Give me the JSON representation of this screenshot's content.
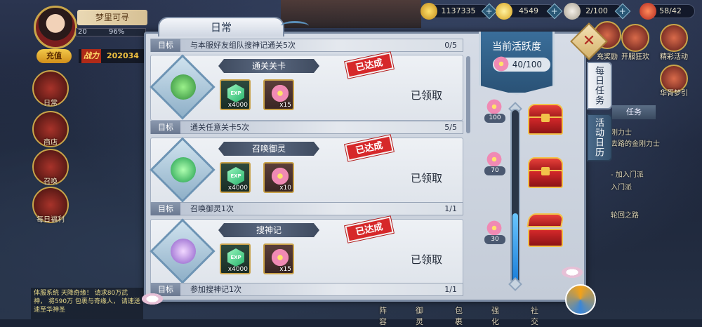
{
  "resources": {
    "gold": "1137335",
    "ingot": "4549",
    "stamina": "2/100",
    "energy": "58/42"
  },
  "player": {
    "name": "梦里可寻",
    "level": "20",
    "exp_percent": "96%",
    "recharge_label": "充值",
    "power_label": "战力",
    "power_value": "202034"
  },
  "left_nav": [
    {
      "label": "日常",
      "icon": "daily-icon"
    },
    {
      "label": "商店",
      "icon": "shop-icon"
    },
    {
      "label": "召唤",
      "icon": "summon-icon"
    },
    {
      "label": "每日福利",
      "icon": "daily-welfare-icon"
    }
  ],
  "right_menu": [
    {
      "label": "充奖励"
    },
    {
      "label": "开服狂欢"
    },
    {
      "label": "精彩活动"
    },
    {
      "label": "华胥梦引"
    }
  ],
  "task_panel": {
    "tab_label": "任务",
    "lines": [
      "刚力士",
      "去路的金刚力士",
      "- 加入门派",
      "入门派",
      "轮回之路"
    ]
  },
  "bottom_nav": [
    "阵容",
    "御灵",
    "包裹",
    "强化",
    "社交"
  ],
  "chat_text": "体服系统 天降奇缘！ 请求80万武神， 将590万 包裹与奇缘人， 请速送速至华神圣",
  "modal": {
    "title": "日常",
    "close_icon": "close-icon",
    "top_goal": {
      "tag": "目标",
      "text": "与本服好友组队搜神记通关5次",
      "count": "0/5"
    },
    "tasks": [
      {
        "name": "通关关卡",
        "stamp": "已达成",
        "rewards": [
          {
            "type": "exp",
            "label": "EXP",
            "qty": "x4000"
          },
          {
            "type": "flower",
            "qty": "x15"
          }
        ],
        "status": "已领取",
        "goal_tag": "目标",
        "goal_text": "通关任意关卡5次",
        "goal_count": "5/5"
      },
      {
        "name": "召唤御灵",
        "stamp": "已达成",
        "rewards": [
          {
            "type": "exp",
            "label": "EXP",
            "qty": "x4000"
          },
          {
            "type": "flower",
            "qty": "x10"
          }
        ],
        "status": "已领取",
        "goal_tag": "目标",
        "goal_text": "召唤御灵1次",
        "goal_count": "1/1"
      },
      {
        "name": "搜神记",
        "stamp": "已达成",
        "rewards": [
          {
            "type": "exp",
            "label": "EXP",
            "qty": "x4000"
          },
          {
            "type": "flower",
            "qty": "x15"
          }
        ],
        "status": "已领取",
        "goal_tag": "目标",
        "goal_text": "参加搜神记1次",
        "goal_count": "1/1"
      }
    ],
    "activity": {
      "title": "当前活跃度",
      "value": "40/100",
      "progress_fraction": 0.4,
      "milestones": [
        "100",
        "70",
        "30"
      ]
    },
    "side_tabs": [
      "每日任务",
      "活动日历"
    ]
  },
  "colors": {
    "stamp_red": "#d6282a",
    "accent_blue": "#3a6e9a",
    "gold": "#f2c24a"
  }
}
